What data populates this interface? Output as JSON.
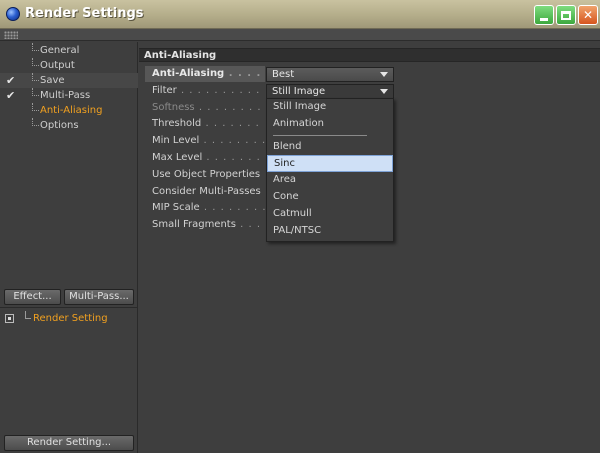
{
  "window": {
    "title": "Render Settings"
  },
  "sidebar": {
    "items": [
      {
        "label": "General",
        "checked": false
      },
      {
        "label": "Output",
        "checked": false
      },
      {
        "label": "Save",
        "checked": true
      },
      {
        "label": "Multi-Pass",
        "checked": true
      },
      {
        "label": "Anti-Aliasing",
        "checked": false,
        "active": true
      },
      {
        "label": "Options",
        "checked": false
      }
    ],
    "effect_button": "Effect...",
    "multipass_button": "Multi-Pass...",
    "render_setting_item": "Render Setting",
    "render_setting_button": "Render Setting..."
  },
  "main": {
    "section_title": "Anti-Aliasing",
    "rows": [
      {
        "label": "Anti-Aliasing",
        "dots": "",
        "value": "Best"
      },
      {
        "label": "Filter",
        "dots": " . . . . . . . . . . . . . . . . . . .",
        "value": "Still Image"
      },
      {
        "label": "Softness",
        "dots": " . . . . . . . . . . . . . . ."
      },
      {
        "label": "Threshold",
        "dots": " . . . . . . . . . . . . . ."
      },
      {
        "label": "Min Level",
        "dots": " . . . . . . . . . . . . . ."
      },
      {
        "label": "Max Level",
        "dots": " . . . . . . . . . . . . . ."
      },
      {
        "label": "Use Object Properties",
        "dots": " . . ."
      },
      {
        "label": "Consider Multi-Passes",
        "dots": " . . ."
      },
      {
        "label": "MIP Scale",
        "dots": " . . . . . . . . . . . . . ."
      },
      {
        "label": "Small Fragments",
        "dots": " . . . . . . . ."
      }
    ],
    "filter_options": [
      "Still Image",
      "Animation",
      "Blend",
      "Sinc",
      "Area",
      "Cone",
      "Catmull",
      "PAL/NTSC"
    ],
    "filter_highlighted": "Sinc"
  },
  "colors": {
    "accent": "#f0a020",
    "selection": "#cfe0f6"
  }
}
